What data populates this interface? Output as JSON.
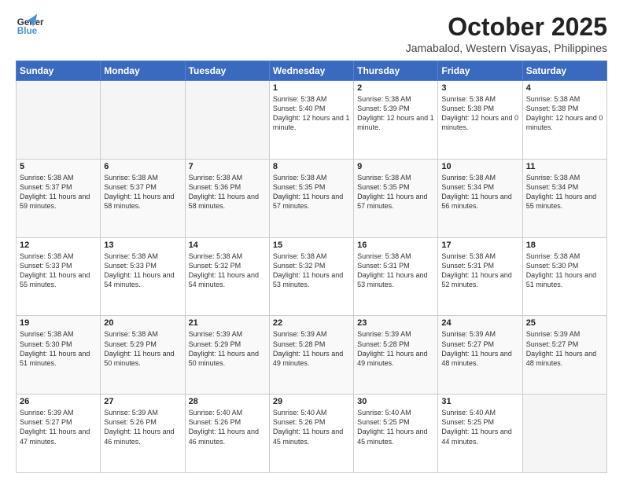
{
  "header": {
    "logo_general": "General",
    "logo_blue": "Blue",
    "month_title": "October 2025",
    "subtitle": "Jamabalod, Western Visayas, Philippines"
  },
  "weekdays": [
    "Sunday",
    "Monday",
    "Tuesday",
    "Wednesday",
    "Thursday",
    "Friday",
    "Saturday"
  ],
  "weeks": [
    [
      {
        "day": "",
        "empty": true
      },
      {
        "day": "",
        "empty": true
      },
      {
        "day": "",
        "empty": true
      },
      {
        "day": "1",
        "sunrise": "5:38 AM",
        "sunset": "5:40 PM",
        "daylight": "12 hours and 1 minute."
      },
      {
        "day": "2",
        "sunrise": "5:38 AM",
        "sunset": "5:39 PM",
        "daylight": "12 hours and 1 minute."
      },
      {
        "day": "3",
        "sunrise": "5:38 AM",
        "sunset": "5:38 PM",
        "daylight": "12 hours and 0 minutes."
      },
      {
        "day": "4",
        "sunrise": "5:38 AM",
        "sunset": "5:38 PM",
        "daylight": "12 hours and 0 minutes."
      }
    ],
    [
      {
        "day": "5",
        "sunrise": "5:38 AM",
        "sunset": "5:37 PM",
        "daylight": "11 hours and 59 minutes."
      },
      {
        "day": "6",
        "sunrise": "5:38 AM",
        "sunset": "5:37 PM",
        "daylight": "11 hours and 58 minutes."
      },
      {
        "day": "7",
        "sunrise": "5:38 AM",
        "sunset": "5:36 PM",
        "daylight": "11 hours and 58 minutes."
      },
      {
        "day": "8",
        "sunrise": "5:38 AM",
        "sunset": "5:35 PM",
        "daylight": "11 hours and 57 minutes."
      },
      {
        "day": "9",
        "sunrise": "5:38 AM",
        "sunset": "5:35 PM",
        "daylight": "11 hours and 57 minutes."
      },
      {
        "day": "10",
        "sunrise": "5:38 AM",
        "sunset": "5:34 PM",
        "daylight": "11 hours and 56 minutes."
      },
      {
        "day": "11",
        "sunrise": "5:38 AM",
        "sunset": "5:34 PM",
        "daylight": "11 hours and 55 minutes."
      }
    ],
    [
      {
        "day": "12",
        "sunrise": "5:38 AM",
        "sunset": "5:33 PM",
        "daylight": "11 hours and 55 minutes."
      },
      {
        "day": "13",
        "sunrise": "5:38 AM",
        "sunset": "5:33 PM",
        "daylight": "11 hours and 54 minutes."
      },
      {
        "day": "14",
        "sunrise": "5:38 AM",
        "sunset": "5:32 PM",
        "daylight": "11 hours and 54 minutes."
      },
      {
        "day": "15",
        "sunrise": "5:38 AM",
        "sunset": "5:32 PM",
        "daylight": "11 hours and 53 minutes."
      },
      {
        "day": "16",
        "sunrise": "5:38 AM",
        "sunset": "5:31 PM",
        "daylight": "11 hours and 53 minutes."
      },
      {
        "day": "17",
        "sunrise": "5:38 AM",
        "sunset": "5:31 PM",
        "daylight": "11 hours and 52 minutes."
      },
      {
        "day": "18",
        "sunrise": "5:38 AM",
        "sunset": "5:30 PM",
        "daylight": "11 hours and 51 minutes."
      }
    ],
    [
      {
        "day": "19",
        "sunrise": "5:38 AM",
        "sunset": "5:30 PM",
        "daylight": "11 hours and 51 minutes."
      },
      {
        "day": "20",
        "sunrise": "5:38 AM",
        "sunset": "5:29 PM",
        "daylight": "11 hours and 50 minutes."
      },
      {
        "day": "21",
        "sunrise": "5:39 AM",
        "sunset": "5:29 PM",
        "daylight": "11 hours and 50 minutes."
      },
      {
        "day": "22",
        "sunrise": "5:39 AM",
        "sunset": "5:28 PM",
        "daylight": "11 hours and 49 minutes."
      },
      {
        "day": "23",
        "sunrise": "5:39 AM",
        "sunset": "5:28 PM",
        "daylight": "11 hours and 49 minutes."
      },
      {
        "day": "24",
        "sunrise": "5:39 AM",
        "sunset": "5:27 PM",
        "daylight": "11 hours and 48 minutes."
      },
      {
        "day": "25",
        "sunrise": "5:39 AM",
        "sunset": "5:27 PM",
        "daylight": "11 hours and 48 minutes."
      }
    ],
    [
      {
        "day": "26",
        "sunrise": "5:39 AM",
        "sunset": "5:27 PM",
        "daylight": "11 hours and 47 minutes."
      },
      {
        "day": "27",
        "sunrise": "5:39 AM",
        "sunset": "5:26 PM",
        "daylight": "11 hours and 46 minutes."
      },
      {
        "day": "28",
        "sunrise": "5:40 AM",
        "sunset": "5:26 PM",
        "daylight": "11 hours and 46 minutes."
      },
      {
        "day": "29",
        "sunrise": "5:40 AM",
        "sunset": "5:26 PM",
        "daylight": "11 hours and 45 minutes."
      },
      {
        "day": "30",
        "sunrise": "5:40 AM",
        "sunset": "5:25 PM",
        "daylight": "11 hours and 45 minutes."
      },
      {
        "day": "31",
        "sunrise": "5:40 AM",
        "sunset": "5:25 PM",
        "daylight": "11 hours and 44 minutes."
      },
      {
        "day": "",
        "empty": true
      }
    ]
  ]
}
